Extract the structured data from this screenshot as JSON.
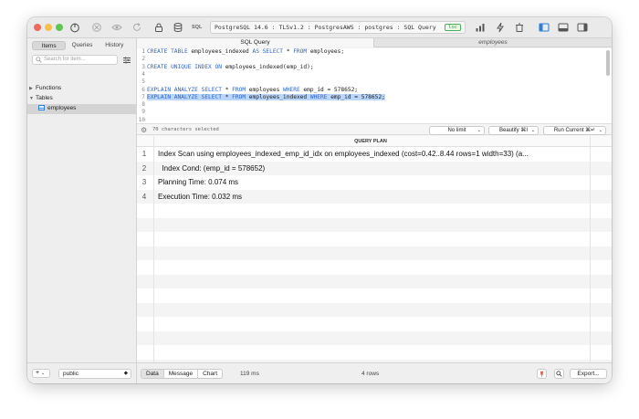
{
  "toolbar": {
    "sql_label": "SQL",
    "connection": "PostgreSQL 14.6 : TLSv1.2 : PostgresAWS : postgres : SQL Query",
    "badge": "loc"
  },
  "sidebar": {
    "tabs": [
      "Items",
      "Queries",
      "History"
    ],
    "active_tab": "Items",
    "search_placeholder": "Search for item...",
    "tree": {
      "functions": "Functions",
      "tables": "Tables",
      "employees": "employees"
    },
    "add": "+",
    "add_chevron": "⌄",
    "schema": "public"
  },
  "tabs": {
    "active": "SQL Query",
    "inactive": "employees"
  },
  "editor": {
    "lines": [
      {
        "n": "1",
        "kw1": "CREATE TABLE",
        "t1": " employees_indexed ",
        "kw2": "AS SELECT",
        "t2": " * ",
        "kw3": "FROM",
        "t3": " employees;"
      },
      {
        "n": "2"
      },
      {
        "n": "3",
        "kw1": "CREATE UNIQUE INDEX ON",
        "t1": " employees_indexed(emp_id);"
      },
      {
        "n": "4"
      },
      {
        "n": "5"
      },
      {
        "n": "6",
        "kw1": "EXPLAIN ANALYZE SELECT",
        "t1": " * ",
        "kw2": "FROM",
        "t2": " employees ",
        "kw3": "WHERE",
        "t3": " emp_id = 578652;"
      },
      {
        "n": "7",
        "kw1": "EXPLAIN ANALYZE SELECT",
        "t1": " * ",
        "kw2": "FROM",
        "t2": " employees_indexed ",
        "kw3": "WHERE",
        "t3": " emp_id = 578652;"
      },
      {
        "n": "8"
      },
      {
        "n": "9"
      },
      {
        "n": "10"
      }
    ],
    "selection_info": "70 characters selected",
    "limit": "No limit",
    "beautify": "Beautify ⌘I",
    "run": "Run Current ⌘↵"
  },
  "results": {
    "column": "QUERY PLAN",
    "rows": [
      {
        "n": "1",
        "text": "Index Scan using employees_indexed_emp_id_idx on employees_indexed  (cost=0.42..8.44 rows=1 width=33) (a..."
      },
      {
        "n": "2",
        "text": "  Index Cond: (emp_id = 578652)"
      },
      {
        "n": "3",
        "text": "Planning Time: 0.074 ms"
      },
      {
        "n": "4",
        "text": "Execution Time: 0.032 ms"
      }
    ]
  },
  "status": {
    "tabs": [
      "Data",
      "Message",
      "Chart"
    ],
    "active": "Data",
    "time": "119 ms",
    "rows": "4 rows",
    "export": "Export..."
  }
}
